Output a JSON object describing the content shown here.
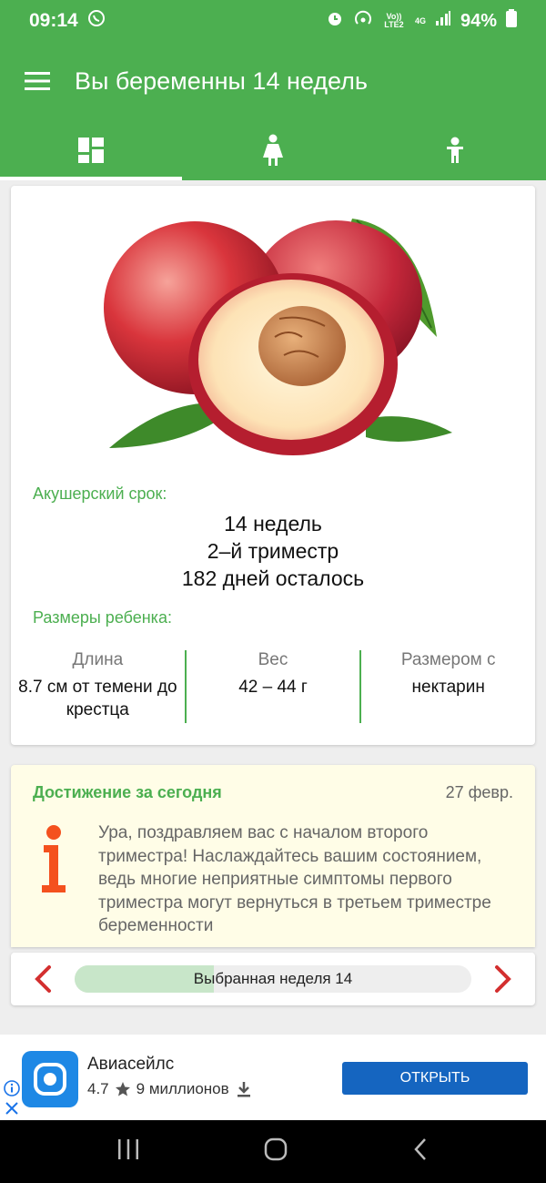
{
  "status": {
    "time": "09:14",
    "volte": "Vo)) LTE2",
    "network": "4G",
    "battery": "94%"
  },
  "header": {
    "title": "Вы беременны 14 недель"
  },
  "tabs": [
    {
      "icon": "dashboard-icon"
    },
    {
      "icon": "woman-icon"
    },
    {
      "icon": "baby-icon"
    }
  ],
  "term": {
    "label": "Акушерский срок:",
    "weeks": "14 недель",
    "trimester": "2–й триместр",
    "days_left": "182 дней осталось"
  },
  "baby_size": {
    "label": "Размеры ребенка:",
    "columns": [
      {
        "label": "Длина",
        "value": "8.7 см от темени до крестца"
      },
      {
        "label": "Вес",
        "value": "42 – 44 г"
      },
      {
        "label": "Размером с",
        "value": "нектарин"
      }
    ]
  },
  "achievement": {
    "title": "Достижение за сегодня",
    "date": "27 февр.",
    "text": "Ура, поздравляем вас с началом второго триместра! Наслаждайтесь вашим состоянием, ведь многие неприятные симптомы первого триместра могут вернуться в третьем триместре беременности"
  },
  "week_nav": {
    "label": "Выбранная неделя 14",
    "progress": 0.35
  },
  "ad": {
    "name": "Авиасейлс",
    "rating": "4.7",
    "installs": "9 миллионов",
    "button": "ОТКРЫТЬ"
  },
  "colors": {
    "primary": "#4caf50",
    "achievement_bg": "#fffde7",
    "ad_button": "#1565c0",
    "nav_arrow": "#d32f2f"
  }
}
